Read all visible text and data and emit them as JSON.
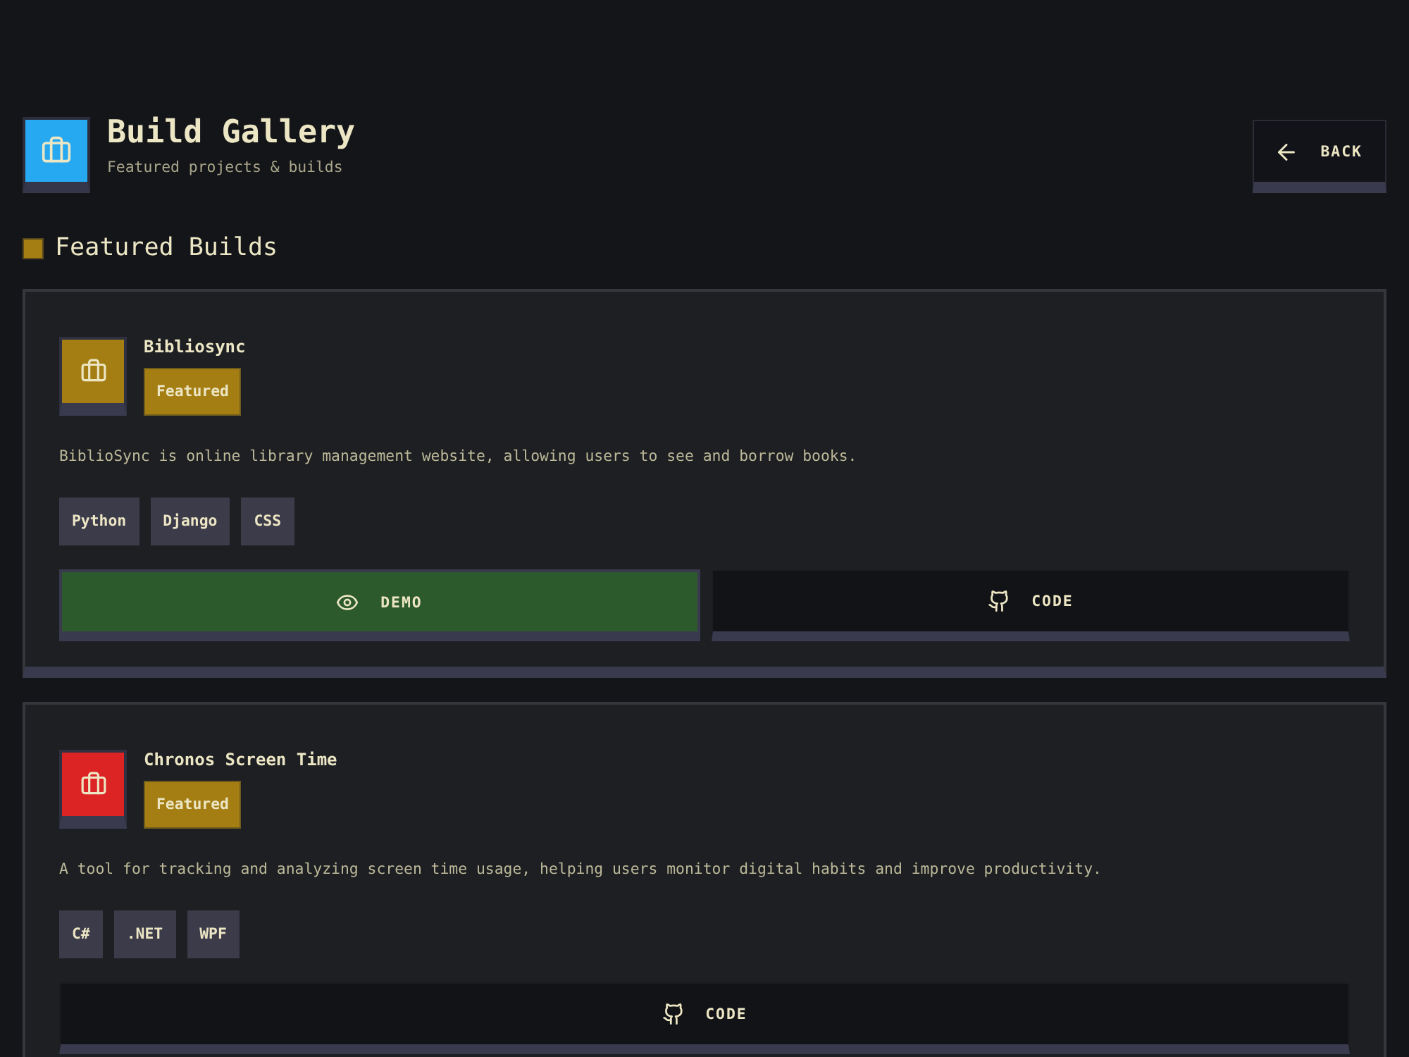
{
  "header": {
    "title": "Build Gallery",
    "subtitle": "Featured projects & builds"
  },
  "back_button": {
    "label": "BACK"
  },
  "section": {
    "title": "Featured Builds"
  },
  "projects": [
    {
      "name": "Bibliosync",
      "color": "#a47e12",
      "badge": "Featured",
      "description": "BiblioSync is online library management website, allowing users to see and borrow books.",
      "tags": [
        "Python",
        "Django",
        "CSS"
      ],
      "actions": [
        {
          "kind": "demo",
          "label": "DEMO"
        },
        {
          "kind": "code",
          "label": "CODE"
        }
      ]
    },
    {
      "name": "Chronos Screen Time",
      "color": "#dc2424",
      "badge": "Featured",
      "description": "A tool for tracking and analyzing screen time usage, helping users monitor digital habits and improve productivity.",
      "tags": [
        "C#",
        ".NET",
        "WPF"
      ],
      "actions": [
        {
          "kind": "code",
          "label": "CODE"
        }
      ]
    }
  ]
}
